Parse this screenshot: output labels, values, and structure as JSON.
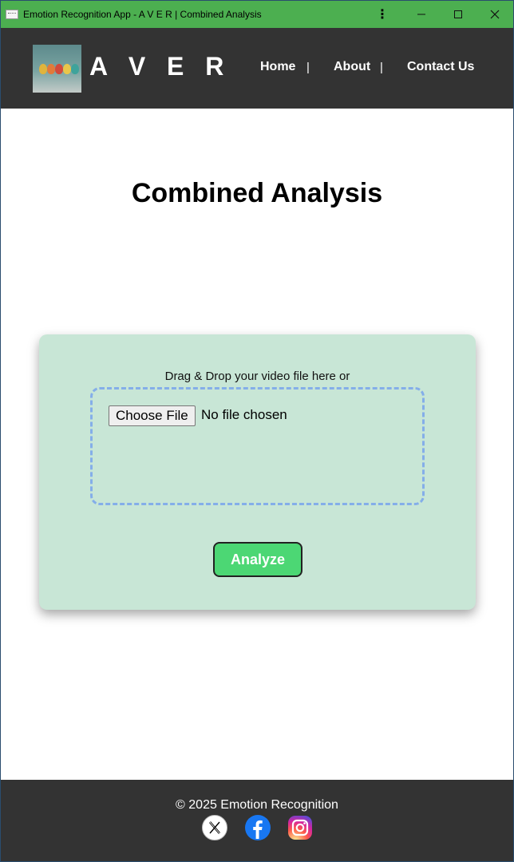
{
  "window": {
    "title": "Emotion Recognition App - A V E R | Combined Analysis",
    "controls": {
      "menu_icon": "more-vertical-icon",
      "minimize_icon": "minimize-icon",
      "maximize_icon": "maximize-icon",
      "close_icon": "close-icon"
    }
  },
  "header": {
    "logo_alt": "colorful-eggs-logo",
    "brand": "A V E R",
    "nav": [
      {
        "label": "Home"
      },
      {
        "label": "About"
      },
      {
        "label": "Contact Us"
      }
    ],
    "separator": "|"
  },
  "main": {
    "title": "Combined Analysis",
    "upload": {
      "drop_label": "Drag & Drop your video file here or",
      "choose_file_label": "Choose File",
      "file_status": "No file chosen"
    },
    "analyze_label": "Analyze"
  },
  "footer": {
    "copyright": "© 2025 Emotion Recognition",
    "social": [
      {
        "icon": "x-twitter-icon"
      },
      {
        "icon": "facebook-icon"
      },
      {
        "icon": "instagram-icon"
      }
    ]
  },
  "colors": {
    "titlebar": "#4caf50",
    "header_bg": "#333333",
    "card_bg": "#c8e6d6",
    "dropzone_border": "#84aee9",
    "analyze_bg": "#4cd774"
  }
}
